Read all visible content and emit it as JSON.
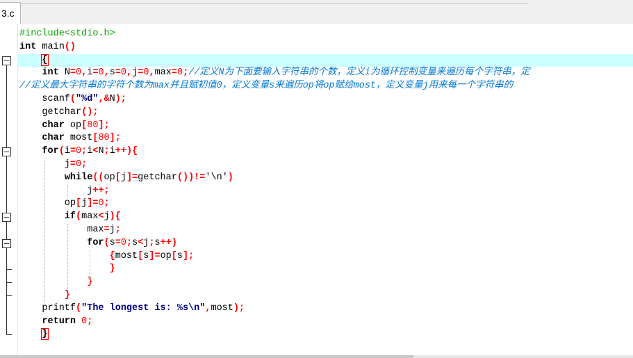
{
  "tab": {
    "label": "3.c"
  },
  "code_lines": [
    {
      "tokens": [
        {
          "t": "pp",
          "v": "#include<stdio.h>"
        }
      ]
    },
    {
      "tokens": [
        {
          "t": "kw",
          "v": "int"
        },
        {
          "t": "plain",
          "v": " main"
        },
        {
          "t": "op",
          "v": "()"
        }
      ]
    },
    {
      "current": true,
      "tokens": [
        {
          "t": "plain",
          "v": "    "
        },
        {
          "t": "bracehl",
          "v": "{"
        }
      ]
    },
    {
      "tokens": [
        {
          "t": "plain",
          "v": "    "
        },
        {
          "t": "kw",
          "v": "int"
        },
        {
          "t": "plain",
          "v": " N"
        },
        {
          "t": "op",
          "v": "="
        },
        {
          "t": "num",
          "v": "0"
        },
        {
          "t": "op",
          "v": ","
        },
        {
          "t": "plain",
          "v": "i"
        },
        {
          "t": "op",
          "v": "="
        },
        {
          "t": "num",
          "v": "0"
        },
        {
          "t": "op",
          "v": ","
        },
        {
          "t": "plain",
          "v": "s"
        },
        {
          "t": "op",
          "v": "="
        },
        {
          "t": "num",
          "v": "0"
        },
        {
          "t": "op",
          "v": ","
        },
        {
          "t": "plain",
          "v": "j"
        },
        {
          "t": "op",
          "v": "="
        },
        {
          "t": "num",
          "v": "0"
        },
        {
          "t": "op",
          "v": ","
        },
        {
          "t": "plain",
          "v": "max"
        },
        {
          "t": "op",
          "v": "="
        },
        {
          "t": "num",
          "v": "0"
        },
        {
          "t": "op",
          "v": ";"
        },
        {
          "t": "cmt",
          "v": "//定义N为下面要输入字符串的个数，定义i为循环控制变量来遍历每个字符串，定"
        }
      ]
    },
    {
      "tokens": [
        {
          "t": "cmt",
          "v": "//定义最大字符串的字符个数为max并且赋初值0，定义变量s来遍历op将op赋给most，定义变量j用来每一个字符串的"
        }
      ]
    },
    {
      "tokens": [
        {
          "t": "plain",
          "v": "    scanf"
        },
        {
          "t": "op",
          "v": "("
        },
        {
          "t": "str",
          "v": "\"%d\""
        },
        {
          "t": "op",
          "v": ",&"
        },
        {
          "t": "plain",
          "v": "N"
        },
        {
          "t": "op",
          "v": ");"
        }
      ]
    },
    {
      "tokens": [
        {
          "t": "plain",
          "v": "    getchar"
        },
        {
          "t": "op",
          "v": "();"
        }
      ]
    },
    {
      "tokens": [
        {
          "t": "plain",
          "v": "    "
        },
        {
          "t": "kw",
          "v": "char"
        },
        {
          "t": "plain",
          "v": " op"
        },
        {
          "t": "op",
          "v": "["
        },
        {
          "t": "num",
          "v": "80"
        },
        {
          "t": "op",
          "v": "];"
        }
      ]
    },
    {
      "tokens": [
        {
          "t": "plain",
          "v": "    "
        },
        {
          "t": "kw",
          "v": "char"
        },
        {
          "t": "plain",
          "v": " most"
        },
        {
          "t": "op",
          "v": "["
        },
        {
          "t": "num",
          "v": "80"
        },
        {
          "t": "op",
          "v": "];"
        }
      ]
    },
    {
      "tokens": [
        {
          "t": "plain",
          "v": "    "
        },
        {
          "t": "kw",
          "v": "for"
        },
        {
          "t": "op",
          "v": "("
        },
        {
          "t": "plain",
          "v": "i"
        },
        {
          "t": "op",
          "v": "="
        },
        {
          "t": "num",
          "v": "0"
        },
        {
          "t": "op",
          "v": ";"
        },
        {
          "t": "plain",
          "v": "i"
        },
        {
          "t": "op",
          "v": "<"
        },
        {
          "t": "plain",
          "v": "N"
        },
        {
          "t": "op",
          "v": ";"
        },
        {
          "t": "plain",
          "v": "i"
        },
        {
          "t": "op",
          "v": "++){"
        }
      ]
    },
    {
      "tokens": [
        {
          "t": "plain",
          "v": "        j"
        },
        {
          "t": "op",
          "v": "="
        },
        {
          "t": "num",
          "v": "0"
        },
        {
          "t": "op",
          "v": ";"
        }
      ]
    },
    {
      "tokens": [
        {
          "t": "plain",
          "v": "        "
        },
        {
          "t": "kw",
          "v": "while"
        },
        {
          "t": "op",
          "v": "(("
        },
        {
          "t": "plain",
          "v": "op"
        },
        {
          "t": "op",
          "v": "["
        },
        {
          "t": "plain",
          "v": "j"
        },
        {
          "t": "op",
          "v": "]="
        },
        {
          "t": "plain",
          "v": "getchar"
        },
        {
          "t": "op",
          "v": "())!="
        },
        {
          "t": "chr",
          "v": "'\\n'"
        },
        {
          "t": "op",
          "v": ")"
        }
      ]
    },
    {
      "tokens": [
        {
          "t": "plain",
          "v": "            j"
        },
        {
          "t": "op",
          "v": "++;"
        }
      ]
    },
    {
      "tokens": [
        {
          "t": "plain",
          "v": "        op"
        },
        {
          "t": "op",
          "v": "["
        },
        {
          "t": "plain",
          "v": "j"
        },
        {
          "t": "op",
          "v": "]="
        },
        {
          "t": "num",
          "v": "0"
        },
        {
          "t": "op",
          "v": ";"
        }
      ]
    },
    {
      "tokens": [
        {
          "t": "plain",
          "v": "        "
        },
        {
          "t": "kw",
          "v": "if"
        },
        {
          "t": "op",
          "v": "("
        },
        {
          "t": "plain",
          "v": "max"
        },
        {
          "t": "op",
          "v": "<"
        },
        {
          "t": "plain",
          "v": "j"
        },
        {
          "t": "op",
          "v": "){"
        }
      ]
    },
    {
      "tokens": [
        {
          "t": "plain",
          "v": "            max"
        },
        {
          "t": "op",
          "v": "="
        },
        {
          "t": "plain",
          "v": "j"
        },
        {
          "t": "op",
          "v": ";"
        }
      ]
    },
    {
      "tokens": [
        {
          "t": "plain",
          "v": "            "
        },
        {
          "t": "kw",
          "v": "for"
        },
        {
          "t": "op",
          "v": "("
        },
        {
          "t": "plain",
          "v": "s"
        },
        {
          "t": "op",
          "v": "="
        },
        {
          "t": "num",
          "v": "0"
        },
        {
          "t": "op",
          "v": ";"
        },
        {
          "t": "plain",
          "v": "s"
        },
        {
          "t": "op",
          "v": "<"
        },
        {
          "t": "plain",
          "v": "j"
        },
        {
          "t": "op",
          "v": ";"
        },
        {
          "t": "plain",
          "v": "s"
        },
        {
          "t": "op",
          "v": "++)"
        }
      ]
    },
    {
      "tokens": [
        {
          "t": "plain",
          "v": "                "
        },
        {
          "t": "op",
          "v": "{"
        },
        {
          "t": "plain",
          "v": "most"
        },
        {
          "t": "op",
          "v": "["
        },
        {
          "t": "plain",
          "v": "s"
        },
        {
          "t": "op",
          "v": "]="
        },
        {
          "t": "plain",
          "v": "op"
        },
        {
          "t": "op",
          "v": "["
        },
        {
          "t": "plain",
          "v": "s"
        },
        {
          "t": "op",
          "v": "];"
        }
      ]
    },
    {
      "tokens": [
        {
          "t": "plain",
          "v": "                "
        },
        {
          "t": "op",
          "v": "}"
        }
      ]
    },
    {
      "tokens": [
        {
          "t": "plain",
          "v": "            "
        },
        {
          "t": "op",
          "v": "}"
        }
      ]
    },
    {
      "tokens": [
        {
          "t": "plain",
          "v": "        "
        },
        {
          "t": "op",
          "v": "}"
        }
      ]
    },
    {
      "tokens": [
        {
          "t": "plain",
          "v": "    printf"
        },
        {
          "t": "op",
          "v": "("
        },
        {
          "t": "str",
          "v": "\"The longest is: %s\\n\""
        },
        {
          "t": "op",
          "v": ","
        },
        {
          "t": "plain",
          "v": "most"
        },
        {
          "t": "op",
          "v": ");"
        }
      ]
    },
    {
      "tokens": [
        {
          "t": "plain",
          "v": "    "
        },
        {
          "t": "kw",
          "v": "return"
        },
        {
          "t": "plain",
          "v": " "
        },
        {
          "t": "num",
          "v": "0"
        },
        {
          "t": "op",
          "v": ";"
        }
      ]
    },
    {
      "tokens": [
        {
          "t": "plain",
          "v": "    "
        },
        {
          "t": "bracehl",
          "v": "}"
        }
      ]
    }
  ],
  "colors": {
    "current_line": "#ccffff",
    "keyword": "#000000",
    "preprocessor": "#00a000",
    "number": "#ff0000",
    "operator": "#ff0000",
    "string": "#000080",
    "comment": "#0078d7"
  }
}
